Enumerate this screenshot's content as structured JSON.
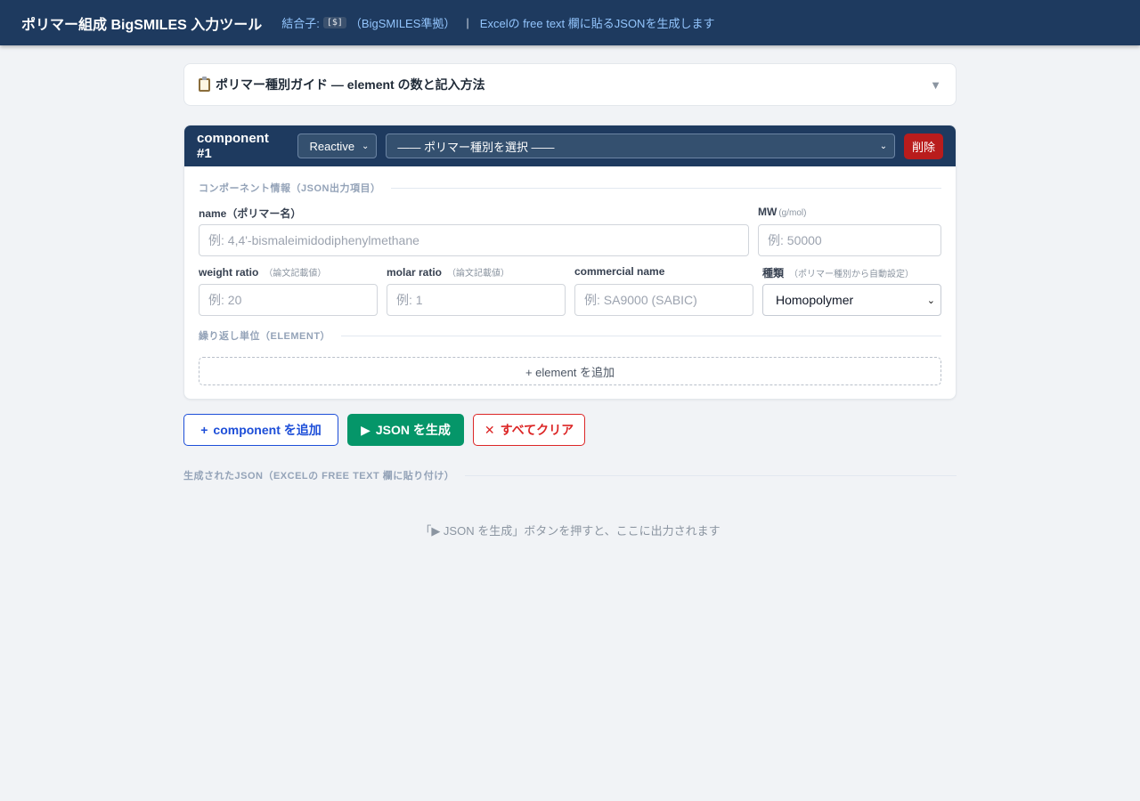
{
  "header": {
    "title": "ポリマー組成 BigSMILES 入力ツール",
    "connector_prefix": "結合子:",
    "connector_code": "[$]",
    "connector_note": "（BigSMILES準拠）",
    "separator": "|",
    "note": "Excelの free text 欄に貼るJSONを生成します"
  },
  "guide": {
    "title": "ポリマー種別ガイド — element の数と記入方法",
    "caret": "▼"
  },
  "component": {
    "title": "component #1",
    "role_select": "Reactive",
    "polymer_select": "—— ポリマー種別を選択 ——",
    "delete_label": "削除",
    "info_section": "コンポーネント情報（JSON出力項目）",
    "fields": {
      "name_label": "name（ポリマー名）",
      "name_placeholder": "例: 4,4'-bismaleimidodiphenylmethane",
      "mw_label": "MW",
      "mw_hint": "(g/mol)",
      "mw_placeholder": "例: 50000",
      "weight_label": "weight ratio",
      "weight_hint": "（論文記載値）",
      "weight_placeholder": "例: 20",
      "molar_label": "molar ratio",
      "molar_hint": "（論文記載値）",
      "molar_placeholder": "例: 1",
      "commercial_label": "commercial name",
      "commercial_placeholder": "例: SA9000 (SABIC)",
      "kind_label": "種類",
      "kind_hint": "（ポリマー種別から自動設定）",
      "kind_value": "Homopolymer"
    },
    "element_section": "繰り返し単位（ELEMENT）",
    "add_element": "+ element を追加"
  },
  "actions": {
    "add_component": "component を追加",
    "generate": "JSON を生成",
    "clear": "すべてクリア"
  },
  "output": {
    "section": "生成されたJSON（EXCELの FREE TEXT 欄に貼り付け）",
    "placeholder": "「▶ JSON を生成」ボタンを押すと、ここに出力されます"
  }
}
